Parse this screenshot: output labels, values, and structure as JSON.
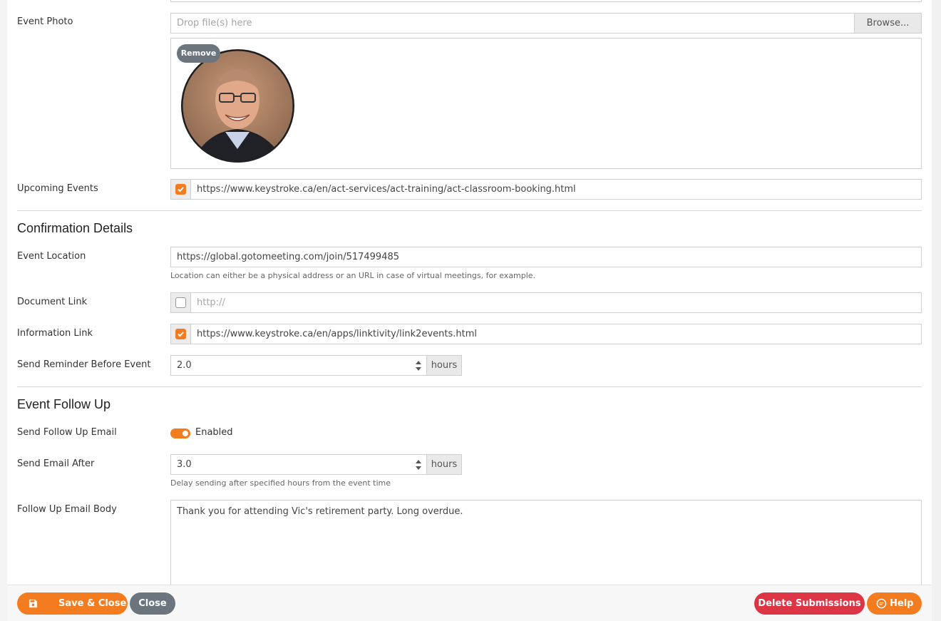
{
  "event_photo": {
    "label": "Event Photo",
    "dropzone_placeholder": "Drop file(s) here",
    "browse_label": "Browse...",
    "remove_label": "Remove"
  },
  "upcoming_events": {
    "label": "Upcoming Events",
    "checked": true,
    "value": "https://www.keystroke.ca/en/act-services/act-training/act-classroom-booking.html"
  },
  "confirmation": {
    "title": "Confirmation Details",
    "event_location": {
      "label": "Event Location",
      "value": "https://global.gotomeeting.com/join/517499485",
      "help": "Location can either be a physical address or an URL in case of virtual meetings, for example."
    },
    "document_link": {
      "label": "Document Link",
      "checked": false,
      "placeholder": "http://"
    },
    "information_link": {
      "label": "Information Link",
      "checked": true,
      "value": "https://www.keystroke.ca/en/apps/linktivity/link2events.html"
    },
    "reminder": {
      "label": "Send Reminder Before Event",
      "value": "2.0",
      "unit": "hours"
    }
  },
  "follow_up": {
    "title": "Event Follow Up",
    "send_email": {
      "label": "Send Follow Up Email",
      "enabled": true,
      "status": "Enabled"
    },
    "send_after": {
      "label": "Send Email After",
      "value": "3.0",
      "unit": "hours",
      "help": "Delay sending after specified hours from the event time"
    },
    "body": {
      "label": "Follow Up Email Body",
      "value": "Thank you for attending Vic's retirement party. Long overdue."
    }
  },
  "footer": {
    "save_close": "Save & Close",
    "close": "Close",
    "delete_submissions": "Delete Submissions",
    "help": "Help"
  },
  "colors": {
    "accent": "#f47c20",
    "danger": "#dc3545",
    "secondary": "#6c757d"
  }
}
